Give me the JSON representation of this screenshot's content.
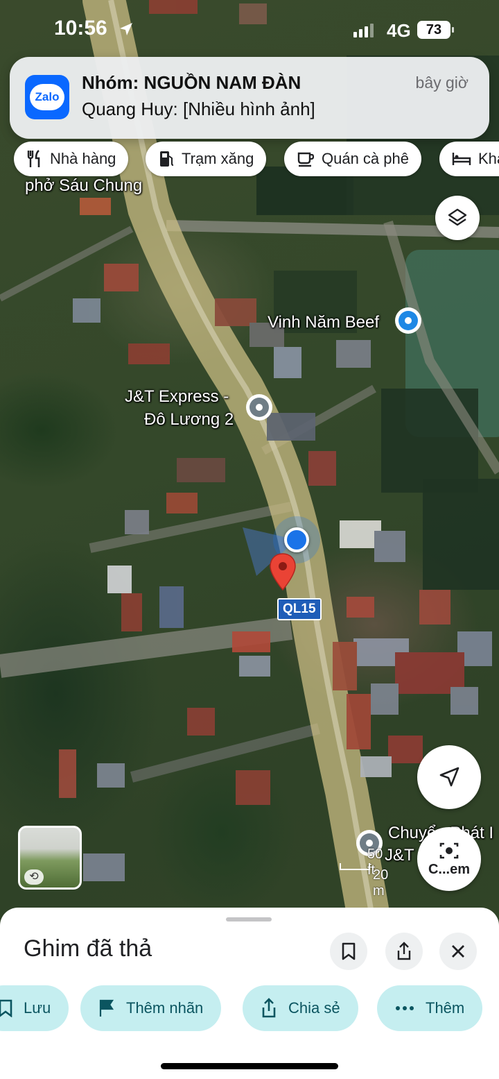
{
  "status_bar": {
    "time": "10:56",
    "network": "4G",
    "battery": "73",
    "icons": [
      "location-arrow-icon",
      "signal-bars-icon",
      "battery-icon"
    ]
  },
  "notification": {
    "app_icon": "zalo-app-icon",
    "app_icon_text": "Zalo",
    "title": "Nhóm: NGUỒN NAM ĐÀN",
    "body": "Quang Huy: [Nhiều hình ảnh]",
    "time": "bây giờ"
  },
  "categories": [
    {
      "label": "Nhà hàng",
      "icon": "restaurant-icon"
    },
    {
      "label": "Trạm xăng",
      "icon": "gas-station-icon"
    },
    {
      "label": "Quán cà phê",
      "icon": "coffee-icon"
    },
    {
      "label": "Kha",
      "icon": "hotel-icon"
    }
  ],
  "map": {
    "type": "satellite",
    "labels": {
      "pho": "phở Sáu Chung",
      "beef": "Vinh Năm Beef",
      "jt_line1": "J&T Express -",
      "jt_line2": "Đô Lương 2",
      "jt2_line1": "Chuyển Phát I",
      "jt2_line2": "J&T"
    },
    "route_shield": "QL15",
    "scale": {
      "label1": "50 ft",
      "label2": "20 m"
    },
    "location_button_icon": "navigation-arrow-icon",
    "layers_button_icon": "layers-icon",
    "camera_button_label": "C...em",
    "camera_button_icon": "camera-search-icon",
    "pin_icon": "red-map-pin-icon"
  },
  "sheet": {
    "title": "Ghim đã thả",
    "icons": [
      "bookmark-icon",
      "share-icon",
      "close-icon"
    ],
    "actions": [
      {
        "label": "Lưu",
        "icon": "bookmark-icon"
      },
      {
        "label": "Thêm nhãn",
        "icon": "flag-icon"
      },
      {
        "label": "Chia sẻ",
        "icon": "share-icon"
      },
      {
        "label": "Thêm",
        "icon": "more-icon"
      }
    ]
  },
  "colors": {
    "accent_teal": "#c5eef0",
    "pin_red": "#ea4335",
    "location_blue": "#1a73e8",
    "zalo_blue": "#0a68ff"
  }
}
